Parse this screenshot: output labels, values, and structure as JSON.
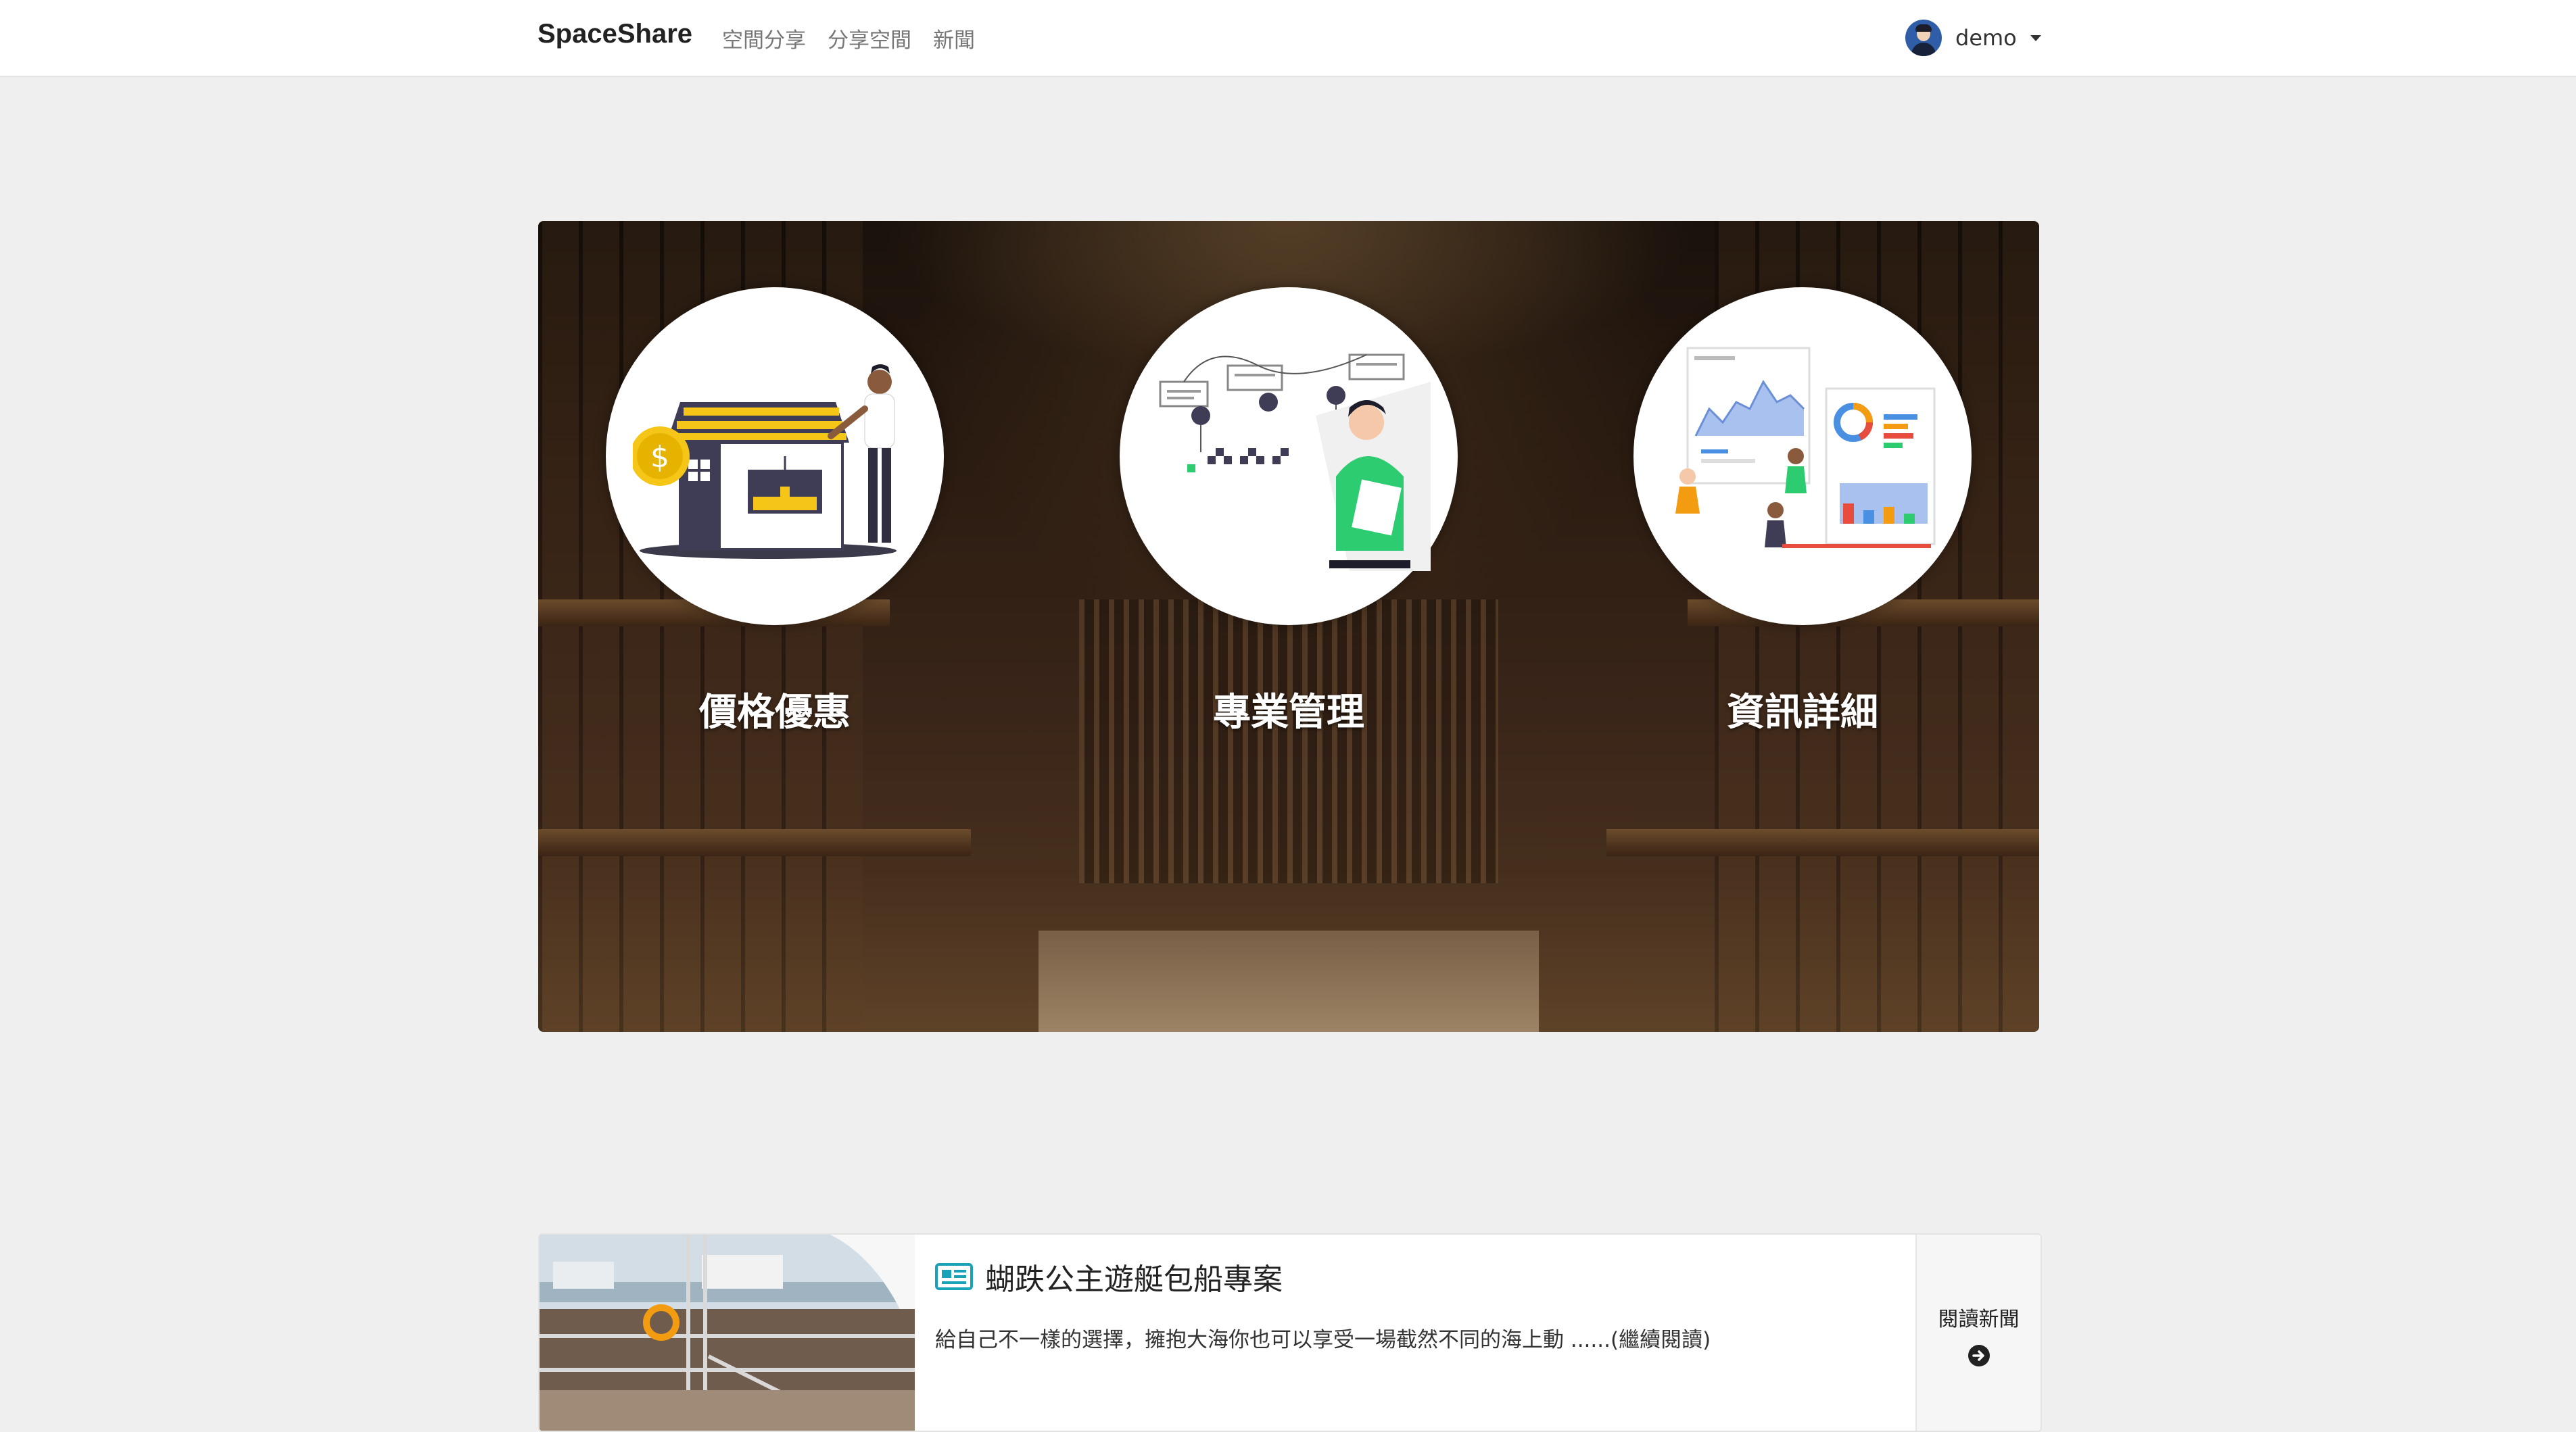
{
  "navbar": {
    "brand": "SpaceShare",
    "links": [
      "空間分享",
      "分享空間",
      "新聞"
    ],
    "user": {
      "name": "demo",
      "icon": "user-avatar-icon"
    }
  },
  "hero": {
    "features": [
      {
        "title": "價格優惠",
        "icon": "house-money-illustration"
      },
      {
        "title": "專業管理",
        "icon": "workflow-illustration"
      },
      {
        "title": "資訊詳細",
        "icon": "dashboard-analytics-illustration"
      }
    ]
  },
  "news": {
    "title": "蝴跌公主遊艇包船專案",
    "description": "給自己不一樣的選擇，擁抱大海你也可以享受一場截然不同的海上動 ......(繼續閱讀)",
    "read_more": "閱讀新聞",
    "icon": "newspaper-icon",
    "accent": "#17a2b8"
  }
}
